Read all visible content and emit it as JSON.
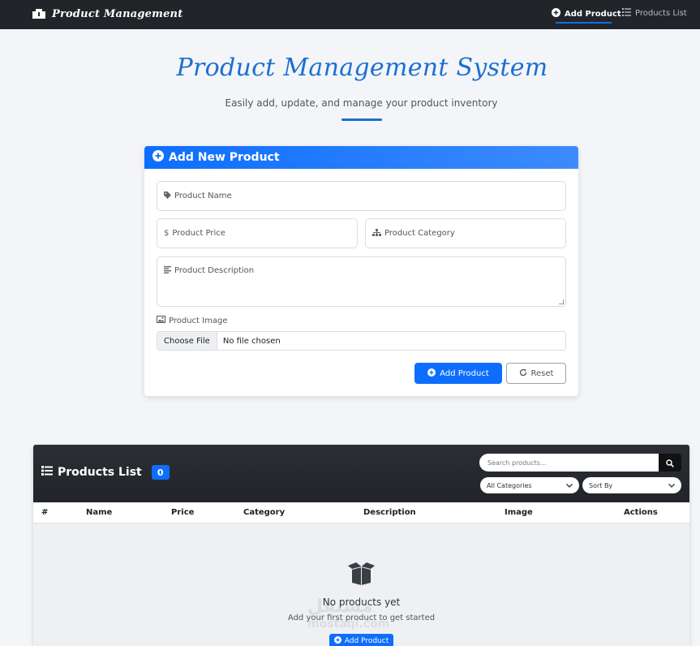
{
  "navbar": {
    "brand": "Product Management",
    "add_product": "Add Product",
    "products_list": "Products List"
  },
  "hero": {
    "title": "Product Management System",
    "subtitle": "Easily add, update, and manage your product inventory"
  },
  "form": {
    "header": "Add New Product",
    "name_placeholder": "Product Name",
    "price_placeholder": "Product Price",
    "category_placeholder": "Product Category",
    "description_placeholder": "Product Description",
    "image_label": "Product Image",
    "choose_file": "Choose File",
    "no_file": "No file chosen",
    "add_button": "Add Product",
    "reset_button": "Reset"
  },
  "products": {
    "title": "Products List",
    "count": "0",
    "search_placeholder": "Search products...",
    "category_filter": "All Categories",
    "sort_by": "Sort By",
    "columns": [
      "#",
      "Name",
      "Price",
      "Category",
      "Description",
      "Image",
      "Actions"
    ],
    "empty_title": "No products yet",
    "empty_sub": "Add your first product to get started",
    "empty_button": "Add Product"
  },
  "watermark": {
    "arabic": "مستقل",
    "latin": "mostaql.com"
  },
  "colors": {
    "primary": "#0d6efd",
    "dark": "#212529",
    "hero": "#1c6fd1"
  }
}
